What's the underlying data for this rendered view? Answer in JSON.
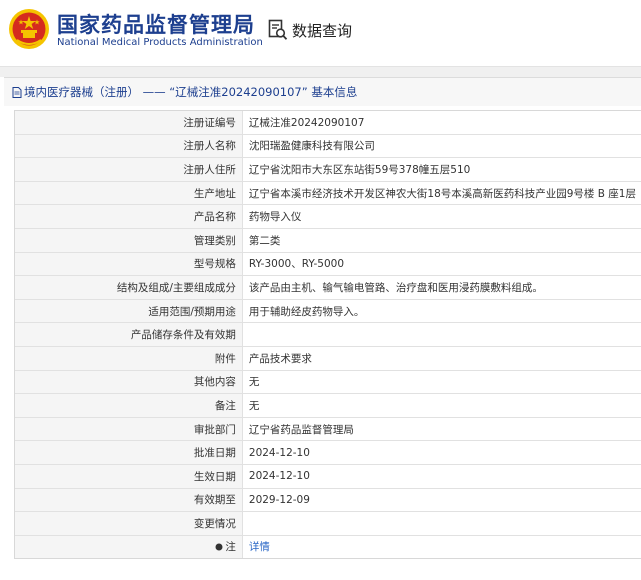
{
  "header": {
    "org_cn": "国家药品监督管理局",
    "org_en": "National Medical Products Administration",
    "query_label": "数据查询"
  },
  "breadcrumb": {
    "text": "境内医疗器械（注册） —— “辽械注准20242090107” 基本信息"
  },
  "rows": [
    {
      "label": "注册证编号",
      "value": "辽械注准20242090107"
    },
    {
      "label": "注册人名称",
      "value": "沈阳瑞盈健康科技有限公司"
    },
    {
      "label": "注册人住所",
      "value": "辽宁省沈阳市大东区东站街59号378幢五层510"
    },
    {
      "label": "生产地址",
      "value": "辽宁省本溪市经济技术开发区神农大街18号本溪高新医药科技产业园9号楼 B 座1层"
    },
    {
      "label": "产品名称",
      "value": "药物导入仪"
    },
    {
      "label": "管理类别",
      "value": "第二类"
    },
    {
      "label": "型号规格",
      "value": "RY-3000、RY-5000"
    },
    {
      "label": "结构及组成/主要组成成分",
      "value": "该产品由主机、输气输电管路、治疗盘和医用浸药膜敷料组成。"
    },
    {
      "label": "适用范围/预期用途",
      "value": "用于辅助经皮药物导入。"
    },
    {
      "label": "产品储存条件及有效期",
      "value": ""
    },
    {
      "label": "附件",
      "value": "产品技术要求"
    },
    {
      "label": "其他内容",
      "value": "无"
    },
    {
      "label": "备注",
      "value": "无"
    },
    {
      "label": "审批部门",
      "value": "辽宁省药品监督管理局"
    },
    {
      "label": "批准日期",
      "value": "2024-12-10"
    },
    {
      "label": "生效日期",
      "value": "2024-12-10"
    },
    {
      "label": "有效期至",
      "value": "2029-12-09"
    },
    {
      "label": "变更情况",
      "value": ""
    }
  ],
  "note_row": {
    "label": "注",
    "link": "详情"
  },
  "colors": {
    "brand_blue": "#1d3f8f",
    "link_blue": "#2a67c6",
    "emblem_red": "#d52b1e",
    "emblem_gold": "#f5c400"
  }
}
